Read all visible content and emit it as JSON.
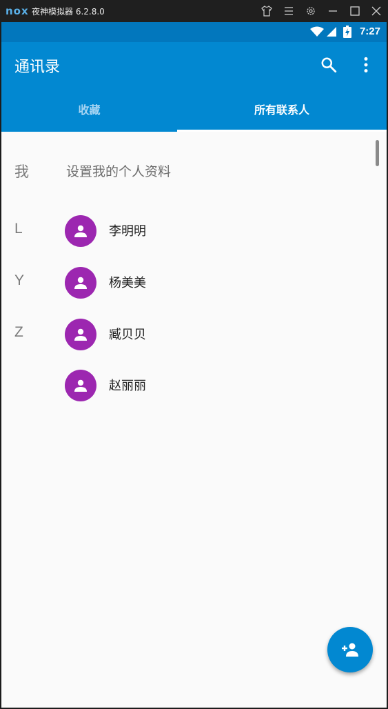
{
  "emulator": {
    "logo": "nox",
    "title": "夜神模拟器 6.2.8.0",
    "buttons": [
      "shirt-icon",
      "menu-icon",
      "gear-icon",
      "minimize-icon",
      "maximize-icon",
      "close-icon"
    ]
  },
  "status_bar": {
    "time": "7:27",
    "icons": [
      "wifi-icon",
      "signal-icon",
      "battery-charging-icon"
    ]
  },
  "app_bar": {
    "title": "通讯录",
    "actions": [
      "search-icon",
      "more-vert-icon"
    ]
  },
  "tabs": [
    {
      "label": "收藏",
      "selected": false
    },
    {
      "label": "所有联系人",
      "selected": true
    }
  ],
  "profile": {
    "letter": "我",
    "label": "设置我的个人资料"
  },
  "contacts": [
    {
      "letter": "L",
      "name": "李明明"
    },
    {
      "letter": "Y",
      "name": "杨美美"
    },
    {
      "letter": "Z",
      "name": "臧贝贝"
    },
    {
      "letter": "",
      "name": "赵丽丽"
    }
  ],
  "fab": {
    "icon": "add-person-icon"
  },
  "colors": {
    "primary": "#0288d1",
    "primary_dark": "#0277bd",
    "avatar": "#9c27b0"
  }
}
